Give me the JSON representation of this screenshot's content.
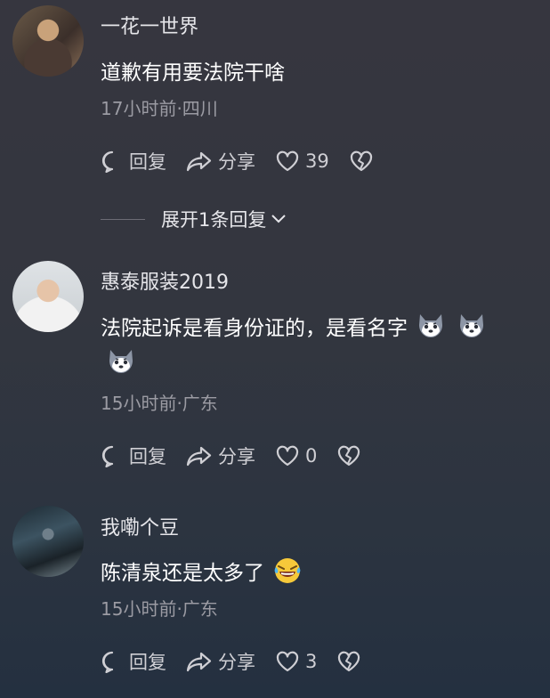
{
  "comments": [
    {
      "username": "一花一世界",
      "text": "道歉有用要法院干啥",
      "time": "17小时前",
      "location": "四川",
      "meta": "17小时前·四川",
      "reply_label": "回复",
      "share_label": "分享",
      "likes": "39"
    },
    {
      "username": "惠泰服装2019",
      "text": "法院起诉是看身份证的，是看名字",
      "emojis": [
        "husky-emoji",
        "husky-emoji",
        "husky-emoji"
      ],
      "time": "15小时前",
      "location": "广东",
      "meta": "15小时前·广东",
      "reply_label": "回复",
      "share_label": "分享",
      "likes": "0"
    },
    {
      "username": "我嘞个豆",
      "text": "陈清泉还是太多了",
      "emojis": [
        "laughing-crying-emoji"
      ],
      "time": "15小时前",
      "location": "广东",
      "meta": "15小时前·广东",
      "reply_label": "回复",
      "share_label": "分享",
      "likes": "3"
    }
  ],
  "expand_replies": {
    "label": "展开1条回复"
  },
  "icons": {
    "reply": "comment-bubble-icon",
    "share": "share-arrow-icon",
    "like": "heart-icon",
    "dislike": "broken-heart-icon",
    "expand": "chevron-down-icon"
  },
  "colors": {
    "text_primary": "#ffffff",
    "text_secondary": "#9b9ba3",
    "icon": "#cfcfd4"
  }
}
